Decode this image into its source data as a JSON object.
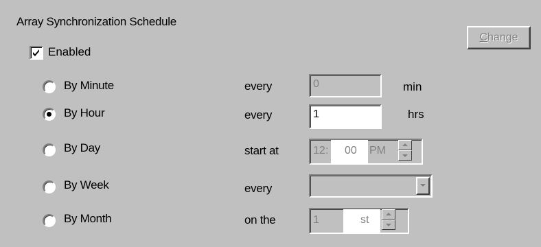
{
  "group": {
    "title": "Array Synchronization Schedule"
  },
  "enabled": {
    "label": "Enabled",
    "checked": true
  },
  "change_button": {
    "mnemonic": "C",
    "rest": "hange",
    "enabled": false
  },
  "rows": [
    {
      "label": "By Minute",
      "selected": false,
      "prompt": "every",
      "value": "0",
      "unit": "min"
    },
    {
      "label": "By Hour",
      "selected": true,
      "prompt": "every",
      "value": "1",
      "unit": "hrs"
    },
    {
      "label": "By Day",
      "selected": false,
      "prompt": "start at",
      "time": {
        "hour": "12",
        "sep": ":",
        "minute": "00",
        "ampm": "PM"
      }
    },
    {
      "label": "By Week",
      "selected": false,
      "prompt": "every",
      "value": ""
    },
    {
      "label": "By Month",
      "selected": false,
      "prompt": "on the",
      "day": "1",
      "suffix": "st"
    }
  ]
}
